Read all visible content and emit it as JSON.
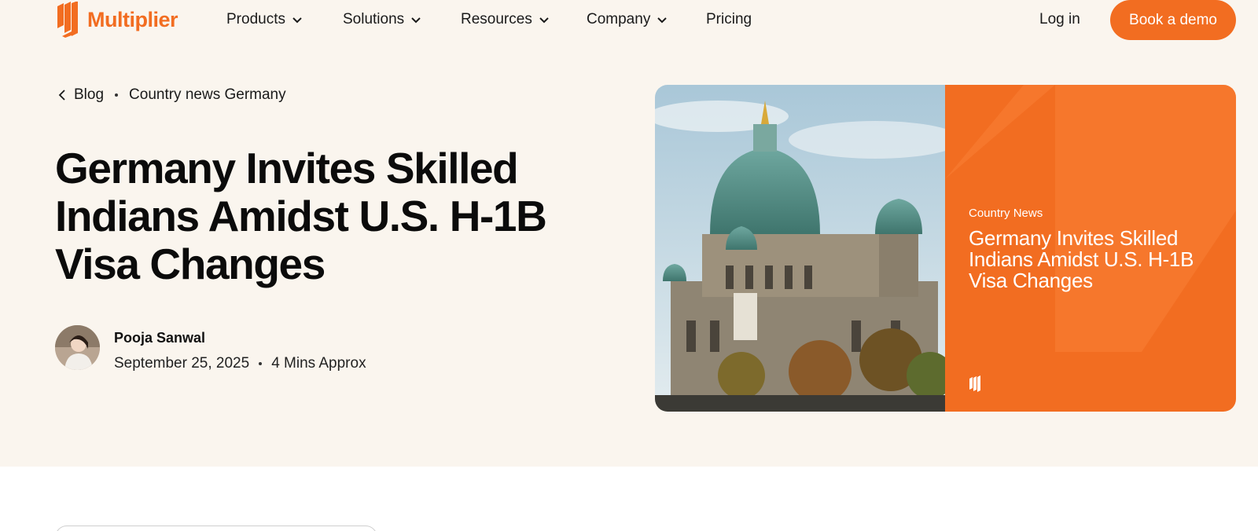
{
  "header": {
    "logo_text": "Multiplier",
    "nav": {
      "products": "Products",
      "solutions": "Solutions",
      "resources": "Resources",
      "company": "Company",
      "pricing": "Pricing"
    },
    "login_label": "Log in",
    "demo_label": "Book a demo"
  },
  "breadcrumb": {
    "back_label": "Blog",
    "current": "Country news Germany"
  },
  "article": {
    "title": "Germany Invites Skilled Indians Amidst U.S. H-1B Visa Changes",
    "author": "Pooja Sanwal",
    "date": "September 25, 2025",
    "read_time": "4 Mins Approx"
  },
  "hero_card": {
    "label": "Country News",
    "title": "Germany Invites Skilled Indians Amidst U.S. H-1B Visa Changes"
  },
  "colors": {
    "brand": "#f26d21",
    "hero_bg": "#faf5ee"
  }
}
